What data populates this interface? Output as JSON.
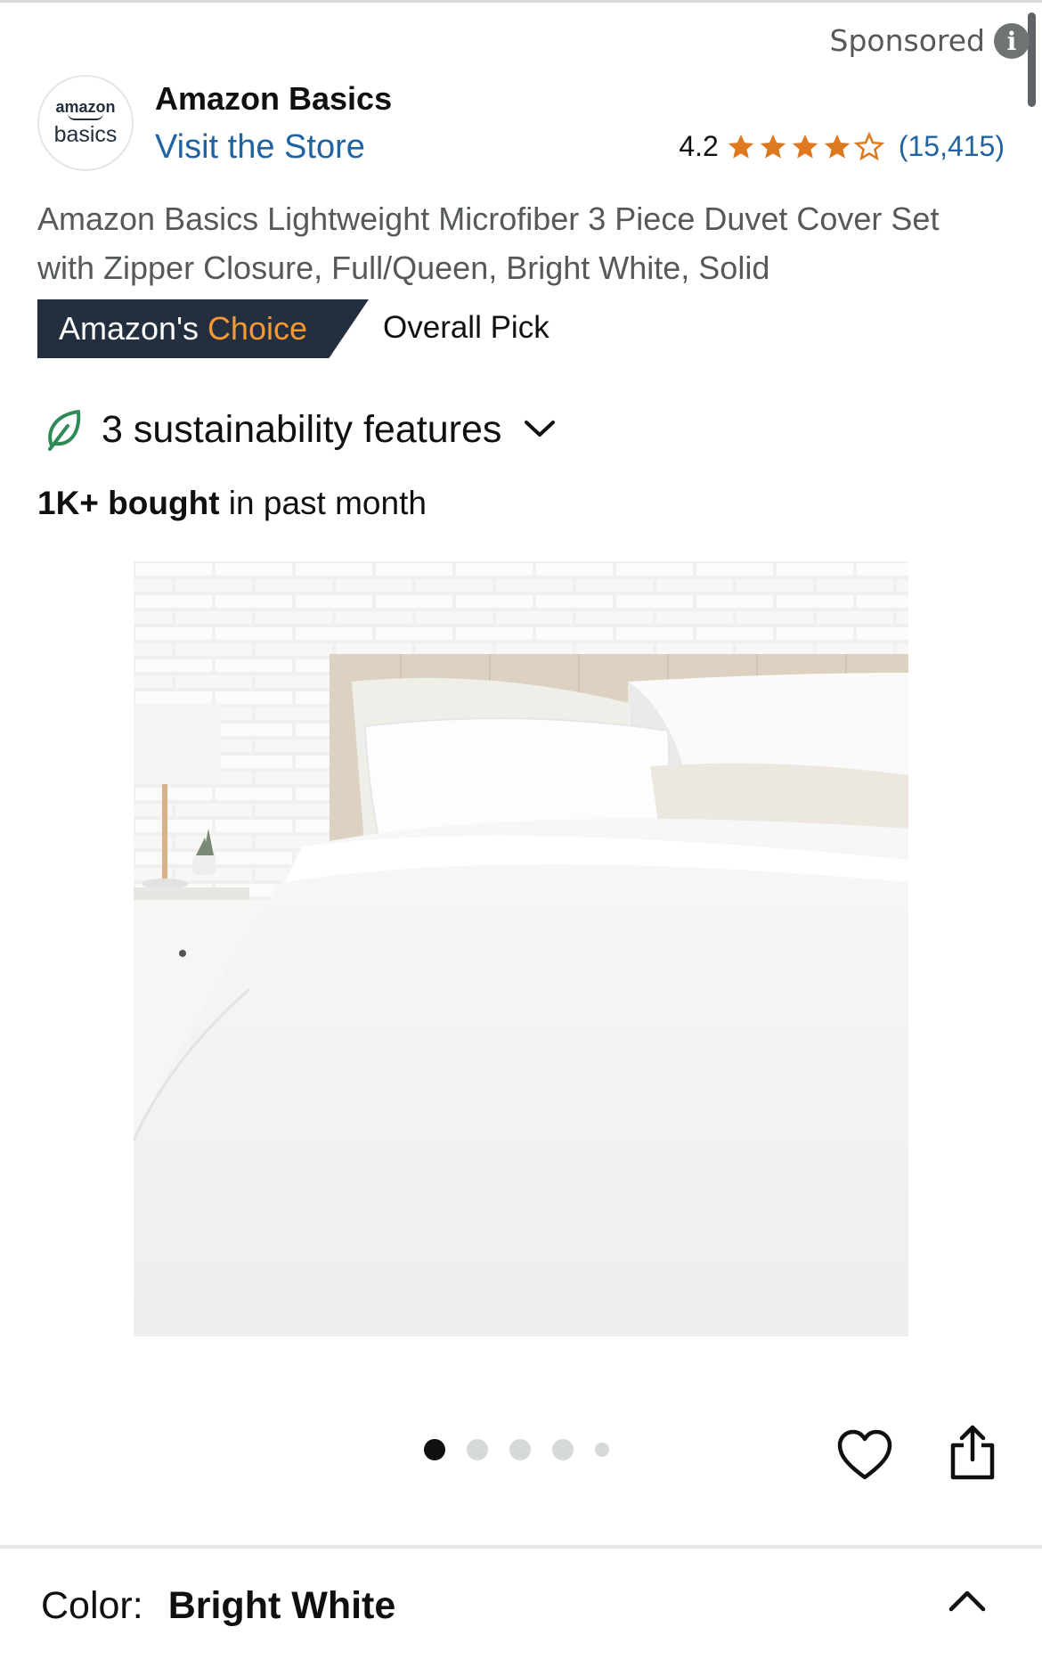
{
  "header": {
    "sponsored_label": "Sponsored",
    "info_icon": "info-icon"
  },
  "brand": {
    "logo_line1": "amazon",
    "logo_line2": "basics",
    "name": "Amazon Basics",
    "store_link": "Visit the Store"
  },
  "rating": {
    "value": "4.2",
    "stars_filled": 4,
    "stars_total": 5,
    "count": "(15,415)",
    "star_color": "#de7921"
  },
  "product": {
    "title": "Amazon Basics Lightweight Microfiber 3 Piece Duvet Cover Set with Zipper Closure, Full/Queen, Bright White, Solid"
  },
  "badge": {
    "part1": "Amazon's",
    "part2": "Choice",
    "pick_label": "Overall Pick",
    "bg_color": "#232f3e",
    "accent_color": "#f69931"
  },
  "sustainability": {
    "label": "3 sustainability features",
    "icon": "leaf-icon"
  },
  "sales": {
    "bold": "1K+ bought",
    "rest": " in past month"
  },
  "gallery": {
    "image_count": 5,
    "active_index": 0,
    "image_alt": "white duvet cover set on bed"
  },
  "actions": {
    "wishlist_icon": "heart-icon",
    "share_icon": "share-icon"
  },
  "variation": {
    "label": "Color:",
    "value": "Bright White"
  }
}
